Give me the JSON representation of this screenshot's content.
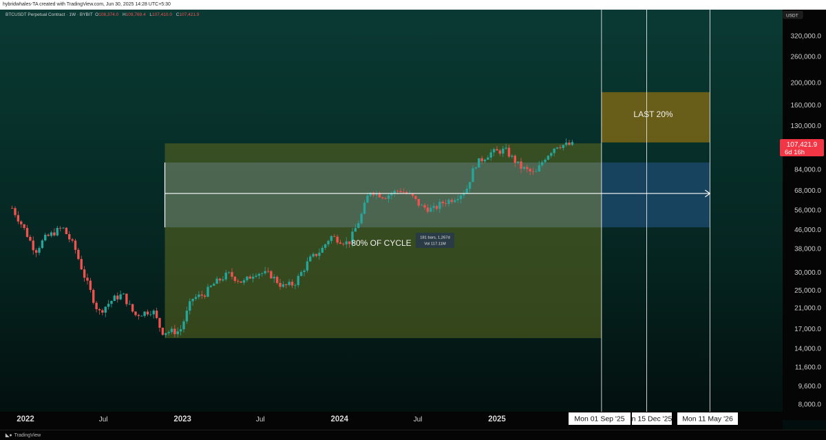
{
  "header": {
    "attribution": "hybridwhales-TA created with TradingView.com, Jun 30, 2025 14:28 UTC+5:30"
  },
  "symbol_line": {
    "name": "BTCUSDT Perpetual Contract · 1W · BYBIT",
    "open_label": "O",
    "open": "108,374.0",
    "high_label": "H",
    "high": "109,769.4",
    "low_label": "L",
    "low": "107,410.0",
    "close_label": "C",
    "close": "107,421.9"
  },
  "price_axis": {
    "currency": "USDT",
    "last_price": "107,421.9",
    "countdown": "6d 16h"
  },
  "annotations": {
    "last_20": "LAST 20%",
    "cycle_80": "80% OF CYCLE",
    "measure_bars": "181 bars, 1,267d",
    "measure_vol": "Vol 117.11M"
  },
  "time_markers": [
    "Mon 01 Sep '25",
    "n 15 Dec '25",
    "Mon 11 May '26"
  ],
  "footer": {
    "brand": "TradingView"
  },
  "colors": {
    "up": "#26a69a",
    "down": "#ef5350",
    "green_zone": "#5f6a1f",
    "gold_zone": "#8a6c14",
    "blue_zone": "#1b4868"
  },
  "chart_data": {
    "type": "candlestick",
    "y_scale": "log",
    "ylim": [
      7400,
      400000
    ],
    "y_ticks": [
      320000,
      260000,
      200000,
      160000,
      130000,
      84000,
      68000,
      56000,
      46000,
      38000,
      30000,
      25000,
      21000,
      17000,
      14000,
      11600,
      9600,
      8000
    ],
    "y_tick_labels": [
      "320,000.0",
      "260,000.0",
      "200,000.0",
      "160,000.0",
      "130,000.0",
      "84,000.0",
      "68,000.0",
      "56,000.0",
      "46,000.0",
      "38,000.0",
      "30,000.0",
      "25,000.0",
      "21,000.0",
      "17,000.0",
      "14,000.0",
      "11,600.0",
      "9,600.0",
      "8,000.0"
    ],
    "x_ticks": [
      {
        "label": "2022",
        "date": "2022-01-01",
        "bold": true
      },
      {
        "label": "Jul",
        "date": "2022-07-01",
        "bold": false
      },
      {
        "label": "2023",
        "date": "2023-01-01",
        "bold": true
      },
      {
        "label": "Jul",
        "date": "2023-07-01",
        "bold": false
      },
      {
        "label": "2024",
        "date": "2024-01-01",
        "bold": true
      },
      {
        "label": "Jul",
        "date": "2024-07-01",
        "bold": false
      },
      {
        "label": "2025",
        "date": "2025-01-01",
        "bold": true
      }
    ],
    "price_path": [
      [
        "2021-12-01",
        57000
      ],
      [
        "2021-12-27",
        47000
      ],
      [
        "2022-01-24",
        37000
      ],
      [
        "2022-02-14",
        42000
      ],
      [
        "2022-03-28",
        47000
      ],
      [
        "2022-04-25",
        38500
      ],
      [
        "2022-05-16",
        29500
      ],
      [
        "2022-06-20",
        20000
      ],
      [
        "2022-07-25",
        23000
      ],
      [
        "2022-08-15",
        24000
      ],
      [
        "2022-09-12",
        19500
      ],
      [
        "2022-10-24",
        20500
      ],
      [
        "2022-11-14",
        16500
      ],
      [
        "2022-12-26",
        16600
      ],
      [
        "2023-01-23",
        23000
      ],
      [
        "2023-02-20",
        24000
      ],
      [
        "2023-03-13",
        26500
      ],
      [
        "2023-04-17",
        29500
      ],
      [
        "2023-05-22",
        27000
      ],
      [
        "2023-06-19",
        30000
      ],
      [
        "2023-07-24",
        29300
      ],
      [
        "2023-08-21",
        26000
      ],
      [
        "2023-09-18",
        26700
      ],
      [
        "2023-10-23",
        34000
      ],
      [
        "2023-11-20",
        37500
      ],
      [
        "2023-12-11",
        43000
      ],
      [
        "2024-01-22",
        40000
      ],
      [
        "2024-02-19",
        52000
      ],
      [
        "2024-03-11",
        68000
      ],
      [
        "2024-04-15",
        64000
      ],
      [
        "2024-05-20",
        68500
      ],
      [
        "2024-06-17",
        64000
      ],
      [
        "2024-07-08",
        58000
      ],
      [
        "2024-08-05",
        56000
      ],
      [
        "2024-08-26",
        60000
      ],
      [
        "2024-09-16",
        62000
      ],
      [
        "2024-10-21",
        68000
      ],
      [
        "2024-11-11",
        88000
      ],
      [
        "2024-12-16",
        99000
      ],
      [
        "2025-01-20",
        102000
      ],
      [
        "2025-02-24",
        86000
      ],
      [
        "2025-03-31",
        80000
      ],
      [
        "2025-04-21",
        94000
      ],
      [
        "2025-05-19",
        107000
      ],
      [
        "2025-06-30",
        107421.9
      ]
    ],
    "zones": [
      {
        "name": "80% OF CYCLE",
        "date_from": "2022-11-21",
        "date_to": "2025-09-01",
        "price_low": 15500,
        "price_high": 109000,
        "color": "#5f6a1f"
      },
      {
        "name": "LAST 20%",
        "date_from": "2025-09-01",
        "date_to": "2026-05-11",
        "price_low": 110000,
        "price_high": 182000,
        "color": "#8a6c14"
      }
    ],
    "measure": {
      "date_from": "2022-11-21",
      "date_to": "2026-05-11",
      "price_low": 47000,
      "price_high": 90000,
      "mid_price": 66000
    },
    "vertical_lines": [
      "2025-09-01",
      "2025-12-15",
      "2026-05-11"
    ]
  }
}
